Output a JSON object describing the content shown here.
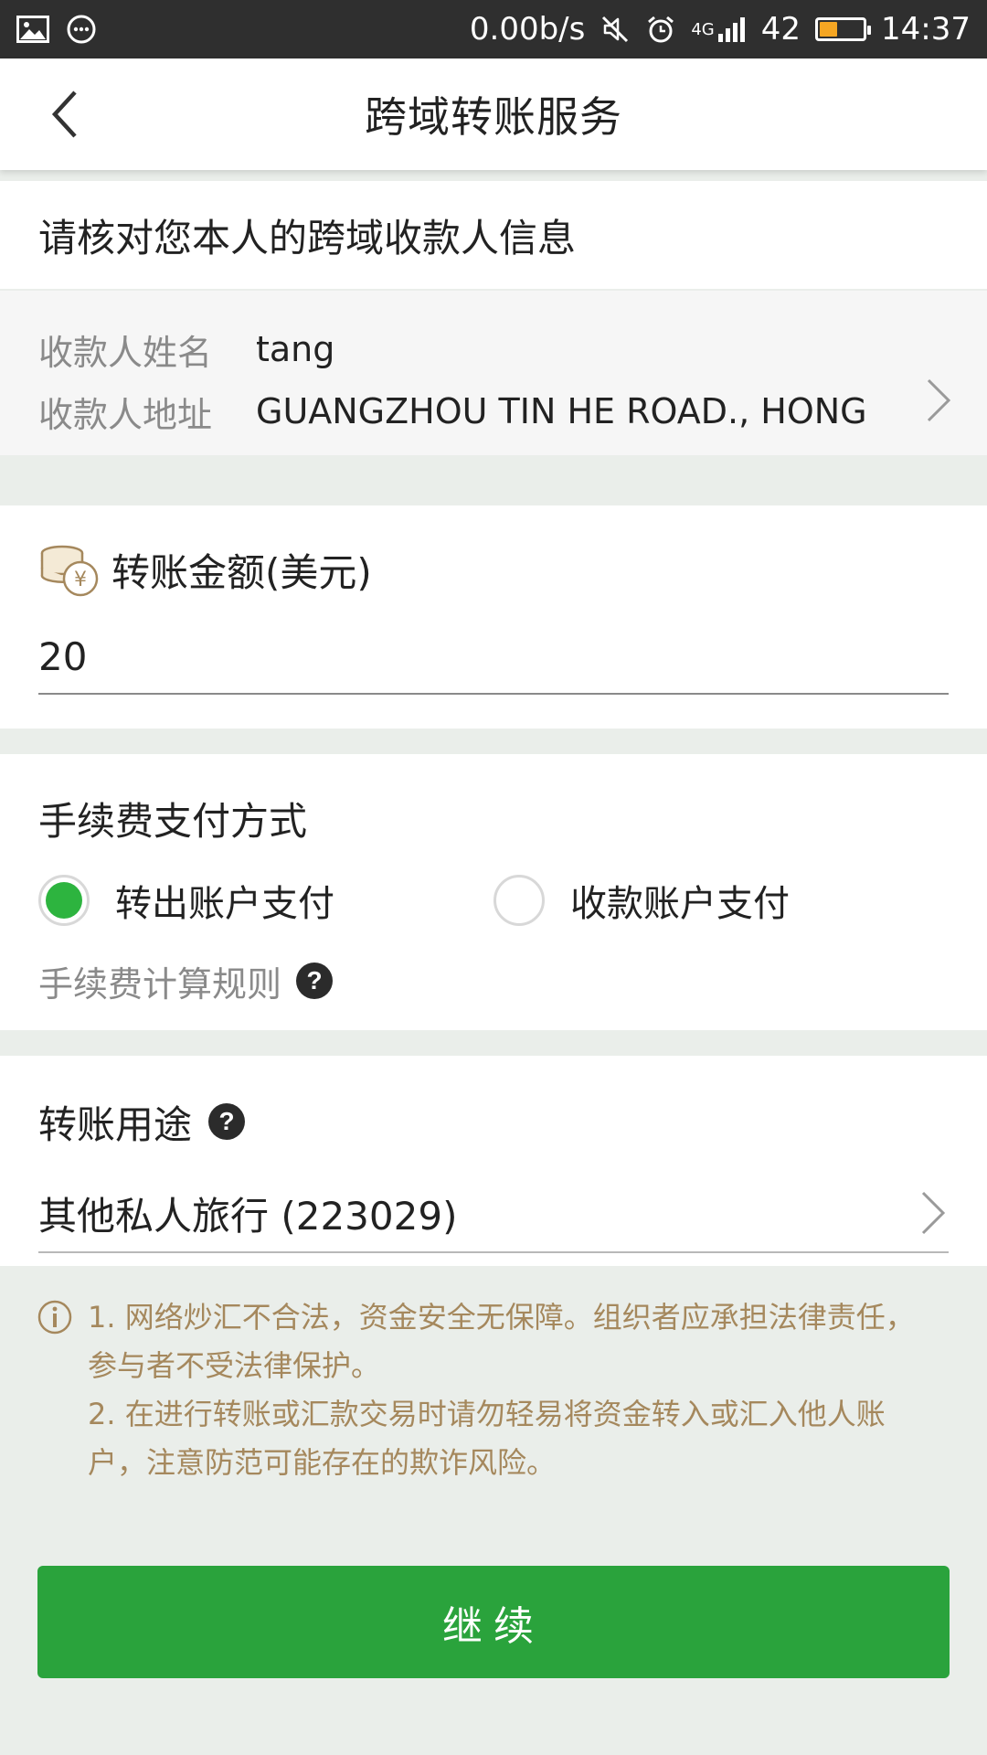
{
  "status_bar": {
    "net_speed": "0.00b/s",
    "network": "4G",
    "battery_level": "42",
    "time": "14:37"
  },
  "header": {
    "title": "跨域转账服务"
  },
  "payee": {
    "heading": "请核对您本人的跨域收款人信息",
    "name_label": "收款人姓名",
    "name_value": "tang",
    "address_label": "收款人地址",
    "address_value": "GUANGZHOU TIN HE ROAD., HONG"
  },
  "amount": {
    "label": "转账金额(美元)",
    "value": "20"
  },
  "fee": {
    "title": "手续费支付方式",
    "options": [
      {
        "label": "转出账户支付",
        "selected": true
      },
      {
        "label": "收款账户支付",
        "selected": false
      }
    ],
    "rule_label": "手续费计算规则",
    "help_symbol": "?"
  },
  "purpose": {
    "label": "转账用途",
    "help_symbol": "?",
    "value": "其他私人旅行 (223029)"
  },
  "notice": {
    "line1": "1. 网络炒汇不合法，资金安全无保障。组织者应承担法律责任，",
    "line2": "参与者不受法律保护。",
    "line3": "2. 在进行转账或汇款交易时请勿轻易将资金转入或汇入他人账",
    "line4": "户，注意防范可能存在的欺诈风险。"
  },
  "actions": {
    "continue_label": "继续"
  },
  "colors": {
    "accent_green": "#2aa33c",
    "radio_green": "#2db43f",
    "notice_text": "#a5885d",
    "page_bg": "#eaeeea"
  }
}
